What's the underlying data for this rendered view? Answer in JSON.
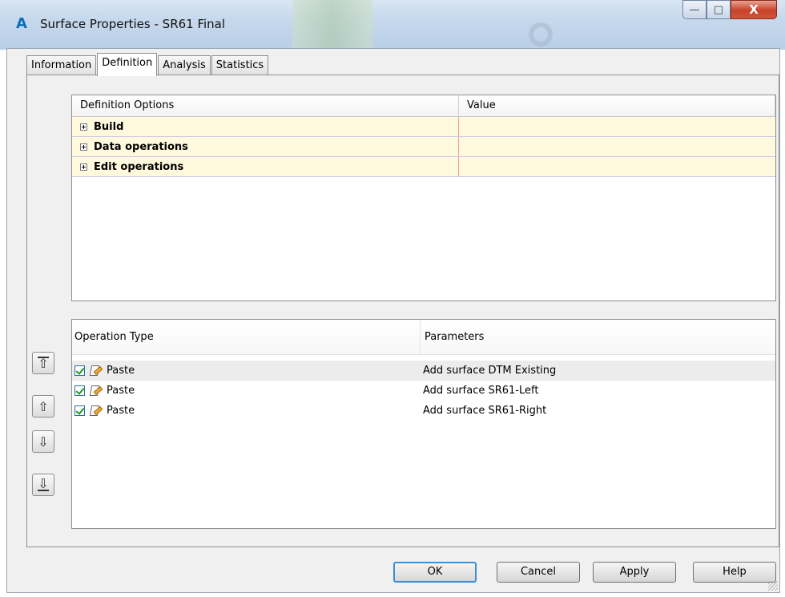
{
  "window": {
    "title": "Surface Properties - SR61 Final",
    "logo": "A",
    "buttons": {
      "minimize": "—",
      "maximize": "□",
      "close": "X"
    }
  },
  "tabs": [
    {
      "label": "Information",
      "active": false
    },
    {
      "label": "Definition",
      "active": true
    },
    {
      "label": "Analysis",
      "active": false
    },
    {
      "label": "Statistics",
      "active": false
    }
  ],
  "definition_grid": {
    "columns": [
      "Definition Options",
      "Value"
    ],
    "rows": [
      {
        "label": "Build",
        "value": ""
      },
      {
        "label": "Data operations",
        "value": ""
      },
      {
        "label": "Edit operations",
        "value": ""
      }
    ]
  },
  "operations": {
    "columns": [
      "Operation Type",
      "Parameters"
    ],
    "rows": [
      {
        "checked": true,
        "type": "Paste",
        "parameters": "Add surface DTM Existing",
        "icon": "paste-icon"
      },
      {
        "checked": true,
        "type": "Paste",
        "parameters": "Add surface SR61-Left",
        "icon": "paste-icon"
      },
      {
        "checked": true,
        "type": "Paste",
        "parameters": "Add surface SR61-Right",
        "icon": "paste-icon"
      }
    ]
  },
  "move_buttons": {
    "top": "⇧",
    "up": "⇧",
    "down": "⇩",
    "bottom": "⇩"
  },
  "footer": {
    "ok": "OK",
    "cancel": "Cancel",
    "apply": "Apply",
    "help": "Help"
  }
}
